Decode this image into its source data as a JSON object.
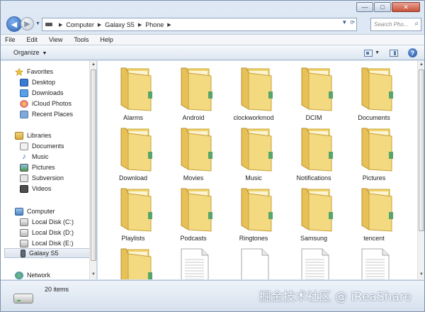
{
  "window": {
    "caption_buttons": {
      "minimize": "—",
      "maximize": "□",
      "close": "✕"
    }
  },
  "address": {
    "crumbs": [
      "Computer",
      "Galaxy S5",
      "Phone"
    ],
    "search_placeholder": "Search Pho..."
  },
  "menu": {
    "items": [
      "File",
      "Edit",
      "View",
      "Tools",
      "Help"
    ]
  },
  "toolbar": {
    "organize_label": "Organize"
  },
  "sidebar": {
    "favorites_label": "Favorites",
    "favorites": [
      {
        "label": "Desktop",
        "icon": "desktop-icon"
      },
      {
        "label": "Downloads",
        "icon": "downloads-icon"
      },
      {
        "label": "iCloud Photos",
        "icon": "icloud-photos-icon"
      },
      {
        "label": "Recent Places",
        "icon": "recent-places-icon"
      }
    ],
    "libraries_label": "Libraries",
    "libraries": [
      {
        "label": "Documents",
        "icon": "documents-icon"
      },
      {
        "label": "Music",
        "icon": "music-icon"
      },
      {
        "label": "Pictures",
        "icon": "pictures-icon"
      },
      {
        "label": "Subversion",
        "icon": "subversion-icon"
      },
      {
        "label": "Videos",
        "icon": "videos-icon"
      }
    ],
    "computer_label": "Computer",
    "computer": [
      {
        "label": "Local Disk (C:)",
        "icon": "local-disk-icon"
      },
      {
        "label": "Local Disk (D:)",
        "icon": "local-disk-icon"
      },
      {
        "label": "Local Disk (E:)",
        "icon": "local-disk-icon"
      },
      {
        "label": "Galaxy S5",
        "icon": "phone-icon",
        "selected": true
      }
    ],
    "network_label": "Network"
  },
  "content": {
    "folders": [
      "Alarms",
      "Android",
      "clockworkmod",
      "DCIM",
      "Documents",
      "Download",
      "Movies",
      "Music",
      "Notifications",
      "Pictures",
      "Playlists",
      "Podcasts",
      "Ringtones",
      "Samsung",
      "tencent"
    ],
    "bottom_row": [
      "folder",
      "text-file",
      "blank-file",
      "text-file",
      "text-file"
    ]
  },
  "status": {
    "item_count": "20 items"
  },
  "watermark": "掘金技术社区 @ iReaShare"
}
